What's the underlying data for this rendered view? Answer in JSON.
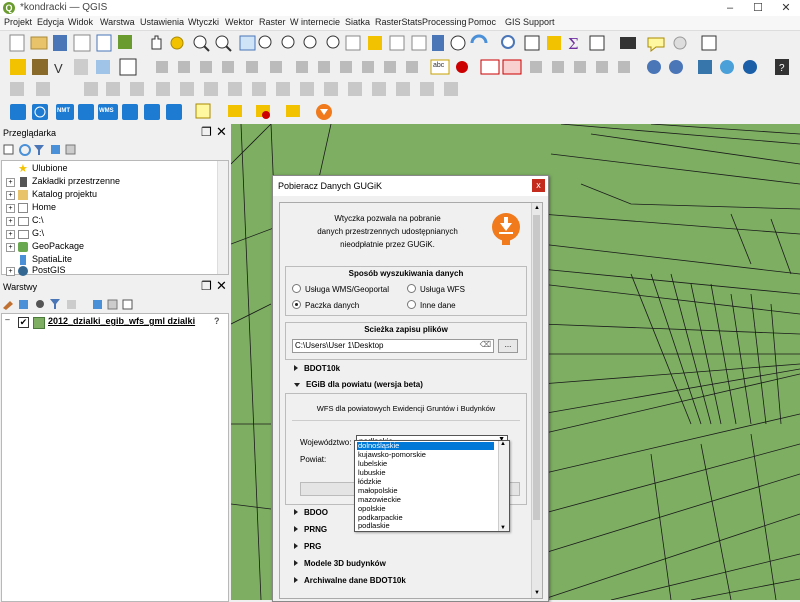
{
  "window": {
    "title": "*kondracki — QGIS",
    "controls": [
      "–",
      "☐",
      "✕"
    ]
  },
  "menubar": [
    "Projekt",
    "Edycja",
    "Widok",
    "Warstwa",
    "Ustawienia",
    "Wtyczki",
    "Wektor",
    "Raster",
    "W internecie",
    "Siatka",
    "RasterStats",
    "Processing",
    "Pomoc",
    "GIS Support"
  ],
  "toolbar_badges": {
    "nmt": "NMT",
    "wms": "WMS",
    "abc": "abc"
  },
  "browser": {
    "title": "Przeglądarka",
    "items": [
      {
        "label": "Ulubione",
        "icon": "star-icon",
        "color": "#f2c200"
      },
      {
        "label": "Zakładki przestrzenne",
        "icon": "bookmark-icon",
        "color": "#333"
      },
      {
        "label": "Katalog projektu",
        "icon": "folder-icon",
        "color": "#e8c36a"
      },
      {
        "label": "Home",
        "icon": "folder-home-icon",
        "color": "#ddd"
      },
      {
        "label": "C:\\",
        "icon": "drive-icon",
        "color": "#ddd"
      },
      {
        "label": "G:\\",
        "icon": "drive-icon",
        "color": "#ddd"
      },
      {
        "label": "GeoPackage",
        "icon": "geopackage-icon",
        "color": "#6aa84f"
      },
      {
        "label": "SpatiaLite",
        "icon": "spatialite-icon",
        "color": "#4a90d9"
      },
      {
        "label": "PostGIS",
        "icon": "postgis-icon",
        "color": "#336791"
      }
    ]
  },
  "layers": {
    "title": "Warstwy",
    "items": [
      {
        "label": "2012_dzialki_egib_wfs_gml dzialki",
        "checked": true,
        "color": "#7dae62",
        "help": "?"
      }
    ]
  },
  "dialog": {
    "title": "Pobieracz Danych GUGiK",
    "close": "x",
    "intro": [
      "Wtyczka pozwala na pobranie",
      "danych przestrzennych udostępnianych",
      "nieodpłatnie przez GUGiK."
    ],
    "search": {
      "title": "Sposób wyszukiwania danych",
      "options": [
        {
          "label": "Usługa WMS/Geoportal",
          "selected": false
        },
        {
          "label": "Usługa WFS",
          "selected": false
        },
        {
          "label": "Paczka danych",
          "selected": true
        },
        {
          "label": "Inne dane",
          "selected": false
        }
      ]
    },
    "path": {
      "title": "Scieżka zapisu plików",
      "value": "C:\\Users\\User 1\\Desktop",
      "browse": "..."
    },
    "sections": [
      {
        "label": "BDOT10k",
        "expanded": false
      },
      {
        "label": "EGiB dla powiatu (wersja beta)",
        "expanded": true
      }
    ],
    "egib": {
      "subtitle": "WFS dla powiatowych Ewidencji Gruntów i Budynków",
      "woj_label": "Województwo:",
      "woj_value": "podlaskie",
      "powiat_label": "Powiat:",
      "options": [
        "dolnośląskie",
        "kujawsko-pomorskie",
        "lubelskie",
        "lubuskie",
        "łódzkie",
        "małopolskie",
        "mazowieckie",
        "opolskie",
        "podkarpackie",
        "podlaskie"
      ],
      "highlighted_index": 0
    },
    "sections_after": [
      "BDOO",
      "PRNG",
      "PRG",
      "Modele 3D budynków",
      "Archiwalne dane BDOT10k"
    ]
  },
  "colors": {
    "map": "#7dae62",
    "accent": "#0078d7",
    "plugin": "#f07a1c"
  }
}
